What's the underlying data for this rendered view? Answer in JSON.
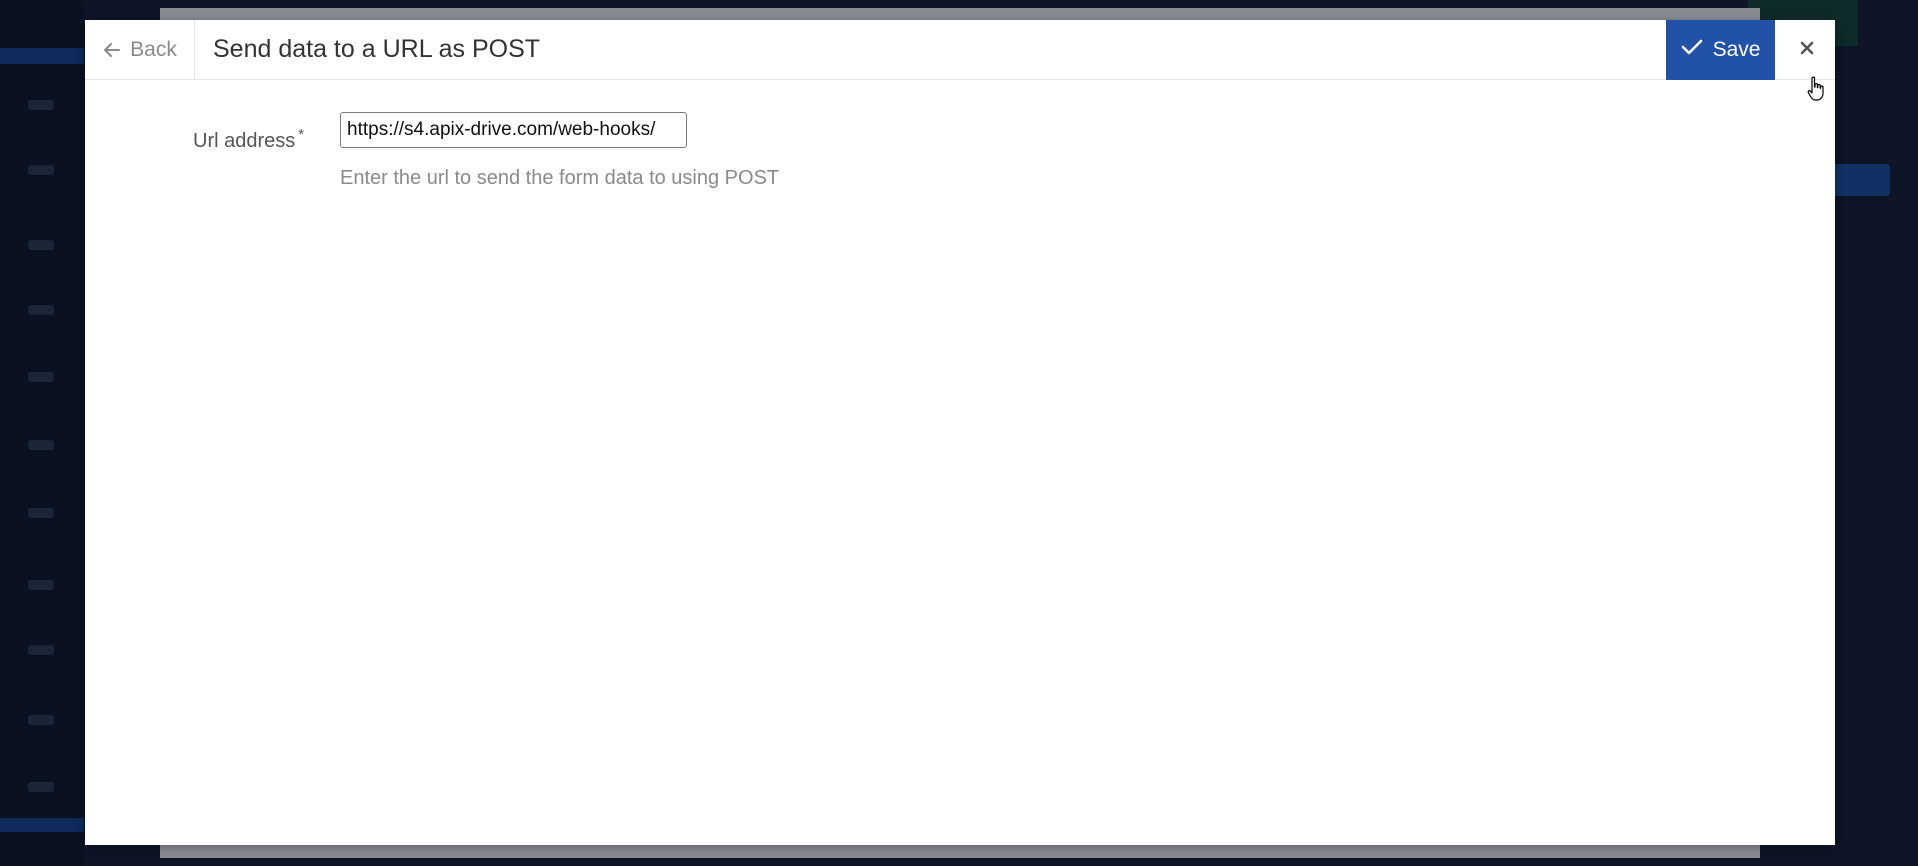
{
  "modal": {
    "back_label": "Back",
    "title": "Send data to a URL as POST",
    "save_label": "Save"
  },
  "form": {
    "url_label": "Url address",
    "required_mark": "*",
    "url_value": "https://s4.apix-drive.com/web-hooks/",
    "hint": "Enter the url to send the form data to using POST"
  },
  "icons": {
    "back": "arrow-left-icon",
    "save": "check-icon",
    "close": "close-icon",
    "cursor": "hand-pointer-icon"
  },
  "colors": {
    "save_button": "#2152a8",
    "backdrop": "#0d1526"
  }
}
